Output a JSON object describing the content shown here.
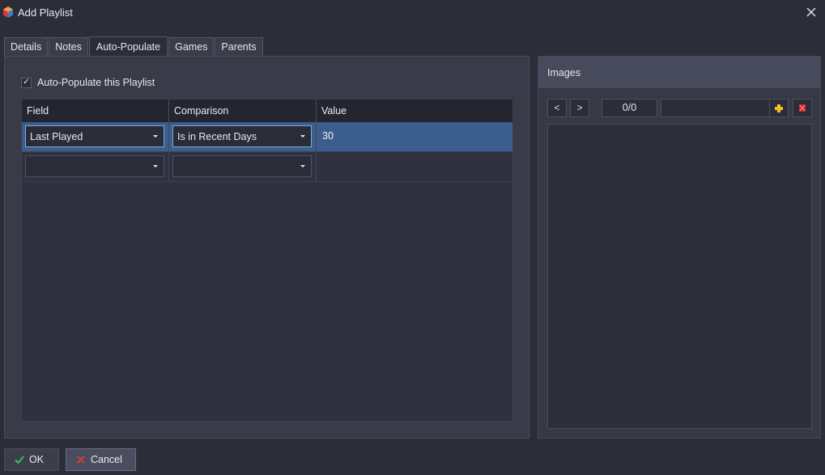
{
  "window": {
    "title": "Add Playlist",
    "icon": "launchbox-cube-icon",
    "close_icon": "close-icon"
  },
  "tabs": [
    {
      "label": "Details",
      "active": false
    },
    {
      "label": "Notes",
      "active": false
    },
    {
      "label": "Auto-Populate",
      "active": true
    },
    {
      "label": "Games",
      "active": false
    },
    {
      "label": "Parents",
      "active": false
    }
  ],
  "auto_populate": {
    "checkbox_label": "Auto-Populate this Playlist",
    "checked": true,
    "columns": [
      "Field",
      "Comparison",
      "Value"
    ],
    "rows": [
      {
        "field": "Last Played",
        "comparison": "Is in Recent Days",
        "value": "30",
        "selected": true
      },
      {
        "field": "",
        "comparison": "",
        "value": "",
        "selected": false
      }
    ]
  },
  "images": {
    "header": "Images",
    "prev_label": "<",
    "next_label": ">",
    "counter": "0/0",
    "add_icon": "add-image-icon",
    "remove_icon": "remove-image-icon"
  },
  "buttons": {
    "ok": "OK",
    "cancel": "Cancel"
  },
  "colors": {
    "background": "#2b2d38",
    "panel": "#393b48",
    "selected_row": "#3b5e8e",
    "ok_check": "#3fbf5a",
    "cancel_x": "#d83a3a",
    "add_icon": "#f2c21a"
  }
}
